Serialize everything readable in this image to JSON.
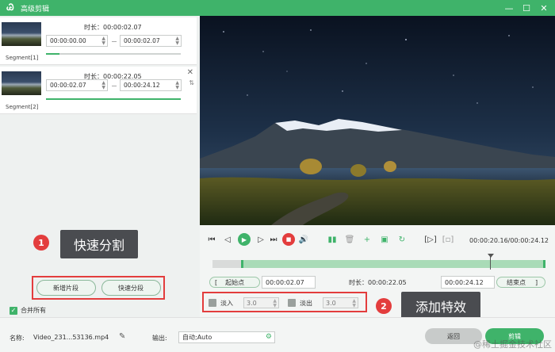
{
  "window": {
    "title": "高级剪辑",
    "logo": "Ꮚ"
  },
  "segments": [
    {
      "label": "Segment[1]",
      "duration": "时长：00:00:02.07",
      "start": "00:00:00.00",
      "end": "00:00:02.07"
    },
    {
      "label": "Segment[2]",
      "duration": "时长：00:00:22.05",
      "start": "00:00:02.07",
      "end": "00:00:24.12"
    }
  ],
  "left_buttons": {
    "new_segment": "新增片段",
    "quick_split": "快速分段"
  },
  "merge_all": {
    "label": "合并所有",
    "checked": true
  },
  "player": {
    "time_display": "00:00:20.16/00:00:24.12"
  },
  "range": {
    "start_label": "起始点",
    "start_value": "00:00:02.07",
    "duration": "时长：00:00:22.05",
    "end_value": "00:00:24.12",
    "end_label": "结束点"
  },
  "fade": {
    "in_label": "淡入",
    "in_value": "3.0",
    "out_label": "淡出",
    "out_value": "3.0"
  },
  "callouts": [
    {
      "number": "1",
      "text": "快速分割"
    },
    {
      "number": "2",
      "text": "添加特效"
    }
  ],
  "footer": {
    "name_label": "名称:",
    "filename": "Video_231...53136.mp4",
    "output_label": "输出:",
    "output_value": "自动;Auto",
    "back_label": "返回",
    "clip_label": "剪辑"
  },
  "watermark": "@稀土掘金技术社区",
  "colors": {
    "accent": "#3fb36a",
    "highlight": "#e33d3d",
    "callout_bg": "#4a4c50"
  }
}
